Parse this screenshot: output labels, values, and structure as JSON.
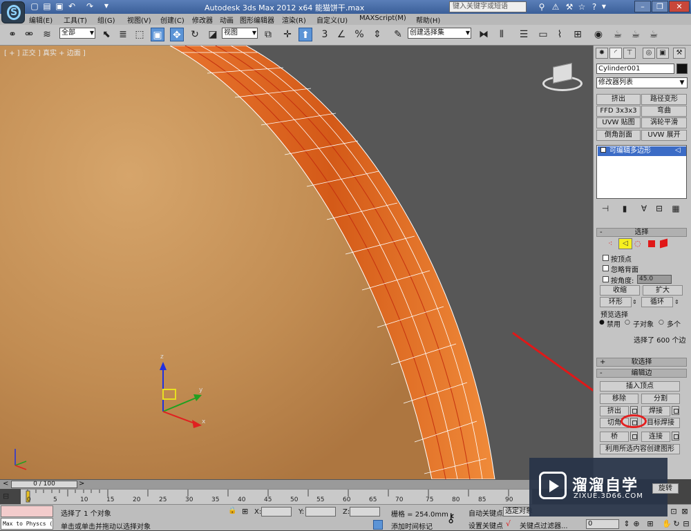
{
  "titlebar": {
    "title": "Autodesk 3ds Max  2012 x64   能猫饼干.max",
    "search_placeholder": "键入关键字或短语",
    "quick_access_icons": [
      "new-icon",
      "open-icon",
      "save-icon",
      "undo-icon",
      "redo-icon",
      "dropdown-icon"
    ],
    "help_icons": [
      "binoculars-icon",
      "communication-icon",
      "star-icon",
      "help-icon"
    ]
  },
  "menubar": {
    "items": [
      "编辑(E)",
      "工具(T)",
      "组(G)",
      "视图(V)",
      "创建(C)",
      "修改器",
      "动画",
      "图形编辑器",
      "渲染(R)",
      "自定义(U)",
      "MAXScript(M)",
      "帮助(H)"
    ]
  },
  "toolbar": {
    "filter_value": "全部",
    "ref_coord_value": "视图",
    "selection_set_value": "创建选择集",
    "snap_label": "3",
    "percent_label": "%"
  },
  "viewport": {
    "label": "[ + ] 正交 ] 真实 + 边面 ]",
    "axis_x": "x",
    "axis_y": "y",
    "axis_z": "z",
    "arrow_color": "#e01818",
    "ring_color": "#e06020",
    "biscuit_color": "#c9915a",
    "background_color": "#575757"
  },
  "command_panel": {
    "tabs": [
      "create-icon",
      "modify-icon",
      "hierarchy-icon",
      "motion-icon",
      "display-icon",
      "utilities-icon"
    ],
    "object_name": "Cylinder001",
    "modifier_list": "修改器列表",
    "modifier_buttons": [
      "挤出",
      "路径变形",
      "FFD 3x3x3",
      "弯曲",
      "UVW 贴图",
      "涡轮平滑",
      "倒角剖面",
      "UVW 展开"
    ],
    "stack_item": "可编辑多边形",
    "selection": {
      "title": "选择",
      "by_vertex": "按顶点",
      "ignore_backfacing": "忽略背面",
      "by_angle": "按角度:",
      "angle_value": "45.0",
      "shrink": "收缩",
      "grow": "扩大",
      "ring": "环形",
      "loop": "循环",
      "preview_title": "预览选择",
      "preview_options": [
        "禁用",
        "子对象",
        "多个"
      ],
      "status": "选择了 600 个边"
    },
    "soft_selection_title": "软选择",
    "edit_edges": {
      "title": "编辑边",
      "insert_vertex": "插入顶点",
      "remove": "移除",
      "split": "分割",
      "extrude": "挤出",
      "weld": "焊接",
      "chamfer": "切角",
      "target_weld": "目标焊接",
      "bridge": "桥",
      "connect": "连接",
      "create_shape": "利用所选内容创建图形",
      "rotate": "旋转"
    }
  },
  "timeline": {
    "thumb": "0 / 100",
    "ticks": [
      "0",
      "5",
      "10",
      "15",
      "20",
      "25",
      "30",
      "35",
      "40",
      "45",
      "50",
      "55",
      "60",
      "65",
      "70",
      "75",
      "80",
      "85",
      "90"
    ]
  },
  "statusbar": {
    "maxscript": "Max to Physcs (",
    "status1": "选择了 1 个对象",
    "status2": "单击或单击并拖动以选择对象",
    "x_label": "X:",
    "y_label": "Y:",
    "z_label": "Z:",
    "grid": "栅格 = 254.0mm",
    "auto_key": "自动关键点",
    "auto_key_value": "选定对象",
    "set_key": "设置关键点",
    "key_filters": "关键点过滤器...",
    "add_time_tag": "添加时间标记",
    "frame_value": "0"
  },
  "watermark": {
    "title": "溜溜自学",
    "subtitle": "ZIXUE.3D66.COM"
  }
}
